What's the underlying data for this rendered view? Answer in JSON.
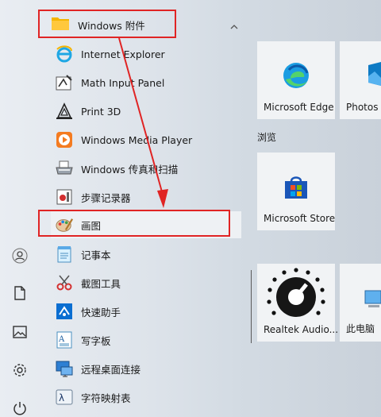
{
  "group": {
    "label": "Windows 附件"
  },
  "items": [
    {
      "label": "Internet Explorer"
    },
    {
      "label": "Math Input Panel"
    },
    {
      "label": "Print 3D"
    },
    {
      "label": "Windows Media Player"
    },
    {
      "label": "Windows 传真和扫描"
    },
    {
      "label": "步骤记录器"
    },
    {
      "label": "画图"
    },
    {
      "label": "记事本"
    },
    {
      "label": "截图工具"
    },
    {
      "label": "快速助手"
    },
    {
      "label": "写字板"
    },
    {
      "label": "远程桌面连接"
    },
    {
      "label": "字符映射表"
    }
  ],
  "tiles": {
    "edge": "Microsoft Edge",
    "photos": "Photos",
    "browse_section": "浏览",
    "store": "Microsoft Store",
    "realtek": "Realtek Audio...",
    "thispc": "此电脑"
  },
  "colors": {
    "annotation": "#e02424",
    "accent": "#0078d4"
  }
}
